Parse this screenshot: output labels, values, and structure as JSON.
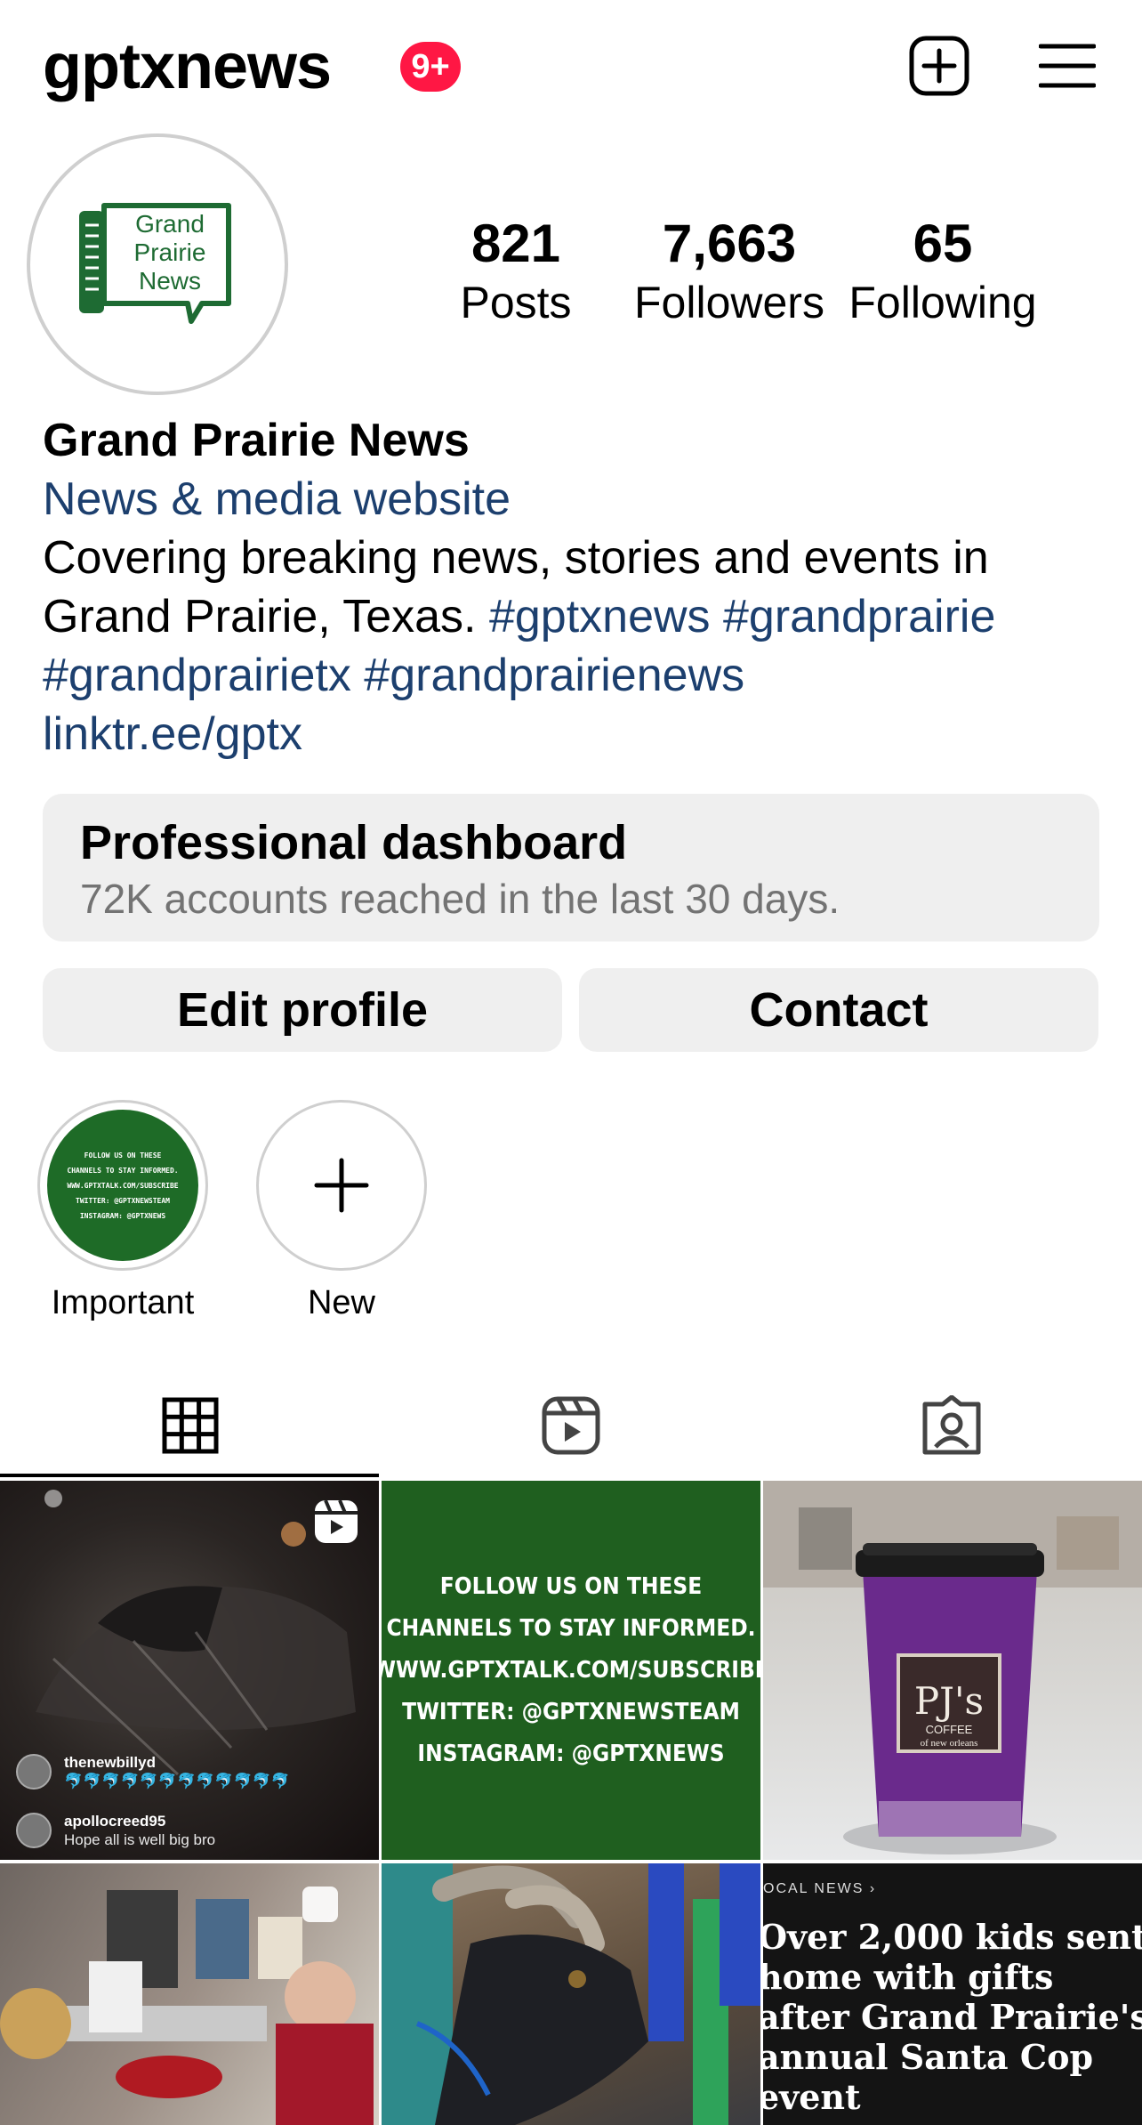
{
  "header": {
    "username": "gptxnews",
    "notification_badge": "9+",
    "new_post_icon": "plus-square-icon",
    "menu_icon": "hamburger-menu-icon"
  },
  "profile": {
    "avatar_logo_text": [
      "Grand",
      "Prairie",
      "News"
    ],
    "stats": [
      {
        "value": "821",
        "label": "Posts"
      },
      {
        "value": "7,663",
        "label": "Followers"
      },
      {
        "value": "65",
        "label": "Following"
      }
    ],
    "name": "Grand Prairie News",
    "category": "News & media website",
    "bio_line1": "Covering breaking news, stories and events in",
    "bio_line2_text": "Grand Prairie, Texas.",
    "bio_line2_tags": "#gptxnews #grandprairie",
    "bio_line3_tags": "#grandprairietx #grandprairienews",
    "link": "linktr.ee/gptx"
  },
  "dashboard": {
    "title": "Professional dashboard",
    "subtitle": "72K accounts reached in the last 30 days."
  },
  "buttons": {
    "edit_profile": "Edit profile",
    "contact": "Contact"
  },
  "highlights": [
    {
      "label": "Important",
      "cover_lines": [
        "FOLLOW US ON THESE",
        "CHANNELS TO STAY INFORMED.",
        "WWW.GPTXTALK.COM/SUBSCRIBE",
        "TWITTER: @GPTXNEWSTEAM",
        "INSTAGRAM: @GPTXNEWS"
      ]
    },
    {
      "label": "New"
    }
  ],
  "tabs": [
    {
      "icon": "grid-icon",
      "active": true
    },
    {
      "icon": "reels-icon",
      "active": false
    },
    {
      "icon": "tagged-icon",
      "active": false
    }
  ],
  "posts": {
    "post1_comments": [
      {
        "user": "thenewbillyd",
        "text": "🐬🐬🐬🐬🐬🐬🐬🐬🐬🐬🐬🐬"
      },
      {
        "user": "apollocreed95",
        "text": "Hope all is well big bro"
      }
    ],
    "post2_lines": [
      "FOLLOW US ON THESE",
      "CHANNELS TO STAY INFORMED.",
      "WWW.GPTXTALK.COM/SUBSCRIBE",
      "TWITTER: @GPTXNEWSTEAM",
      "INSTAGRAM: @GPTXNEWS"
    ],
    "post3_cup": {
      "brand": "PJ's",
      "sub": "COFFEE",
      "sub2": "of new orleans"
    },
    "post6_kicker": "OCAL NEWS ›",
    "post6_headline": "Over 2,000 kids sent home with gifts after Grand Prairie's annual Santa Cop event"
  },
  "colors": {
    "link_blue": "#1c3f6e",
    "badge_red": "#ff1744",
    "button_bg": "#efefef",
    "logo_green": "#1e6b33"
  }
}
